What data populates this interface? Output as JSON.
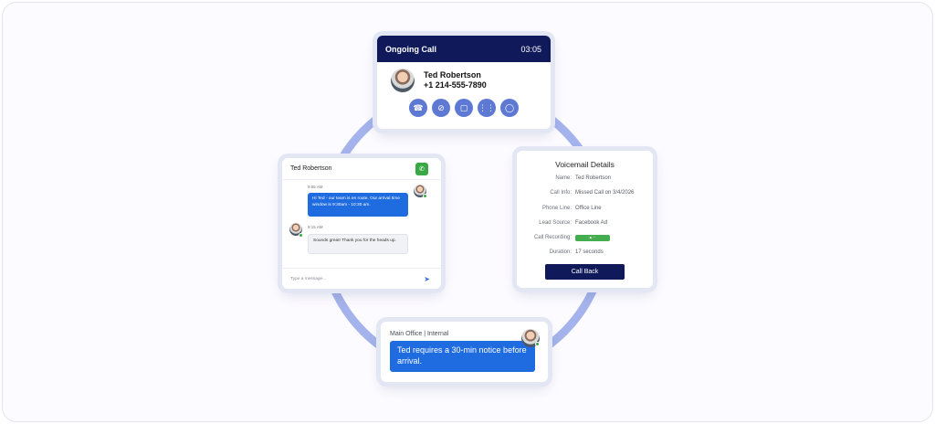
{
  "ongoing_call": {
    "title": "Ongoing Call",
    "timer": "03:05",
    "contact_name": "Ted Robertson",
    "contact_phone": "+1 214-555-7890",
    "actions": [
      {
        "icon": "hang-up-icon",
        "glyph": "☎"
      },
      {
        "icon": "mute-video-icon",
        "glyph": "⊘"
      },
      {
        "icon": "note-icon",
        "glyph": "▢"
      },
      {
        "icon": "keypad-icon",
        "glyph": "⋮⋮"
      },
      {
        "icon": "contact-icon",
        "glyph": "◯"
      }
    ]
  },
  "chat": {
    "contact_name": "Ted Robertson",
    "messages": [
      {
        "direction": "outgoing",
        "time": "9:55 AM",
        "text": "Hi Ted - our team is en route. Our arrival time window is 9:30am - 10:30 am."
      },
      {
        "direction": "incoming",
        "time": "9:15 AM",
        "text": "Sounds great! Thank you for the heads up."
      }
    ],
    "input_placeholder": "Type a message..."
  },
  "voicemail": {
    "title": "Voicemail Details",
    "rows": [
      {
        "label": "Name:",
        "value": "Ted Robertson"
      },
      {
        "label": "Call Info:",
        "value": "Missed Call on 3/4/2026"
      },
      {
        "label": "Phone Line:",
        "value": "Office Line"
      },
      {
        "label": "Lead Source:",
        "value": "Facebook Ad"
      },
      {
        "label": "Call Recording:",
        "value": ""
      },
      {
        "label": "Duration:",
        "value": "17 seconds"
      }
    ],
    "call_back_label": "Call Back"
  },
  "internal_note": {
    "channel": "Main Office | Internal",
    "message": "Ted requires a 30-min notice before arrival."
  },
  "colors": {
    "navy": "#10195a",
    "accent_blue": "#1f6be0",
    "ring": "#a5b3ec",
    "online_green": "#3aa845"
  }
}
